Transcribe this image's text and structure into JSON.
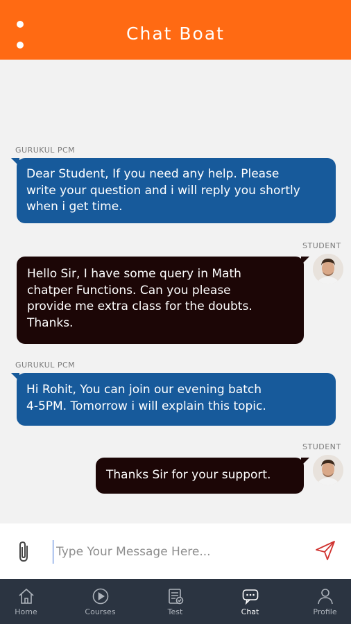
{
  "header": {
    "title": "Chat Boat",
    "color": "#ff6a13"
  },
  "messages": [
    {
      "sender": "GURUKUL PCM",
      "lines": [
        "Dear Student, If you need any help. Please",
        "write your question and i will reply you shortly",
        "when i get time."
      ],
      "direction": "incoming"
    },
    {
      "sender": "STUDENT",
      "lines": [
        "Hello Sir, I have some query in Math",
        "chatper Functions. Can you please",
        "provide me extra class for the doubts.",
        "Thanks."
      ],
      "direction": "outgoing"
    },
    {
      "sender": "GURUKUL PCM",
      "lines": [
        "Hi Rohit, You can join our evening batch",
        "4-5PM. Tomorrow i will explain this topic."
      ],
      "direction": "incoming"
    },
    {
      "sender": "STUDENT",
      "lines": [
        "Thanks Sir for your support."
      ],
      "direction": "outgoing"
    }
  ],
  "composer": {
    "placeholder": "Type Your Message Here...",
    "attach_icon": "paperclip-icon",
    "send_icon": "send-icon"
  },
  "nav": {
    "items": [
      {
        "label": "Home",
        "icon": "home-icon"
      },
      {
        "label": "Courses",
        "icon": "play-circle-icon"
      },
      {
        "label": "Test",
        "icon": "test-icon"
      },
      {
        "label": "Chat",
        "icon": "chat-icon",
        "active": true
      },
      {
        "label": "Profile",
        "icon": "profile-icon"
      }
    ]
  },
  "colors": {
    "incoming_bubble": "#175a9b",
    "outgoing_bubble": "#1c0606",
    "nav_background": "#2b3441"
  }
}
